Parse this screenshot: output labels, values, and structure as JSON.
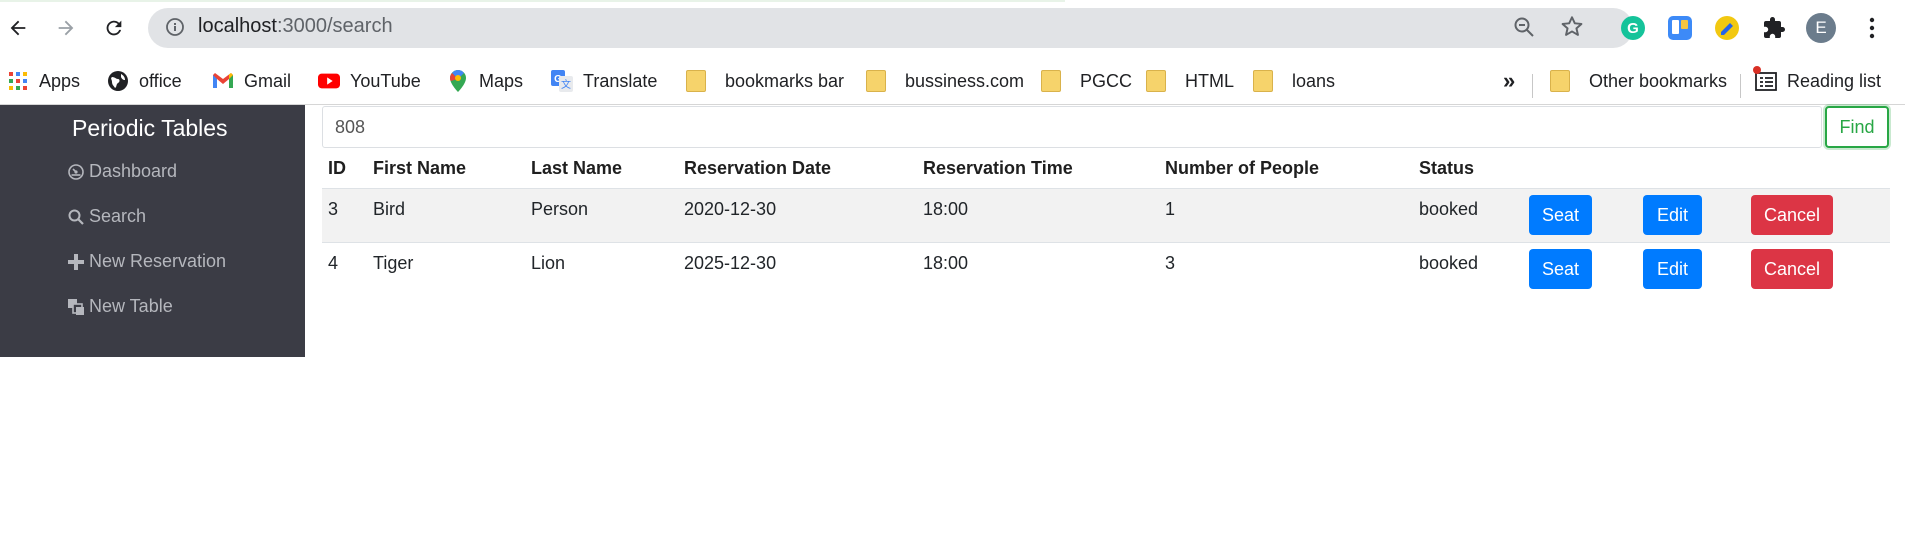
{
  "browser": {
    "url_host": "localhost",
    "url_path": ":3000/search",
    "profile_initial": "E"
  },
  "bookmarks": {
    "items": [
      {
        "label": "Apps",
        "icon": "apps-grid-icon"
      },
      {
        "label": "office",
        "icon": "office-globe-icon"
      },
      {
        "label": "Gmail",
        "icon": "gmail-icon"
      },
      {
        "label": "YouTube",
        "icon": "youtube-icon"
      },
      {
        "label": "Maps",
        "icon": "maps-pin-icon"
      },
      {
        "label": "Translate",
        "icon": "translate-icon"
      },
      {
        "label": "bookmarks bar",
        "icon": "folder-icon"
      },
      {
        "label": "bussiness.com",
        "icon": "folder-icon"
      },
      {
        "label": "PGCC",
        "icon": "folder-icon"
      },
      {
        "label": "HTML",
        "icon": "folder-icon"
      },
      {
        "label": "loans",
        "icon": "folder-icon"
      }
    ],
    "overflow": "»",
    "other": "Other bookmarks",
    "reading_list": "Reading list"
  },
  "sidebar": {
    "title": "Periodic Tables",
    "items": [
      {
        "label": "Dashboard",
        "icon": "dashboard-icon"
      },
      {
        "label": "Search",
        "icon": "search-icon"
      },
      {
        "label": "New Reservation",
        "icon": "plus-icon"
      },
      {
        "label": "New Table",
        "icon": "tables-icon"
      }
    ]
  },
  "search": {
    "value": "808",
    "button": "Find"
  },
  "table": {
    "headers": [
      "ID",
      "First Name",
      "Last Name",
      "Reservation Date",
      "Reservation Time",
      "Number of People",
      "Status"
    ],
    "rows": [
      {
        "id": "3",
        "first": "Bird",
        "last": "Person",
        "date": "2020-12-30",
        "time": "18:00",
        "people": "1",
        "status": "booked"
      },
      {
        "id": "4",
        "first": "Tiger",
        "last": "Lion",
        "date": "2025-12-30",
        "time": "18:00",
        "people": "3",
        "status": "booked"
      }
    ],
    "actions": {
      "seat": "Seat",
      "edit": "Edit",
      "cancel": "Cancel"
    }
  },
  "colors": {
    "sidebar_bg": "#3b3c45",
    "primary": "#007bff",
    "danger": "#dc3545",
    "success": "#28a745"
  }
}
